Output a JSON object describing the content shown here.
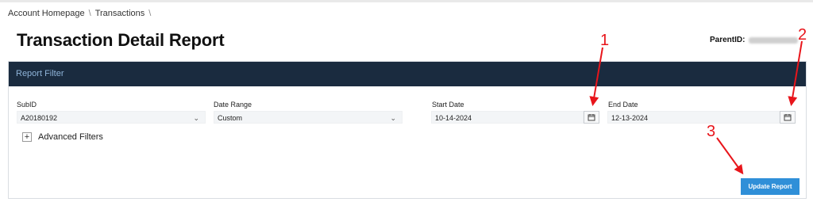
{
  "breadcrumb": {
    "items": [
      "Account Homepage",
      "Transactions"
    ],
    "separator": "\\"
  },
  "page": {
    "title": "Transaction Detail Report",
    "parent_label": "ParentID:"
  },
  "filter": {
    "header": "Report Filter",
    "subid": {
      "label": "SubID",
      "value": "A20180192"
    },
    "date_range": {
      "label": "Date Range",
      "value": "Custom"
    },
    "start_date": {
      "label": "Start Date",
      "value": "10-14-2024"
    },
    "end_date": {
      "label": "End Date",
      "value": "12-13-2024"
    },
    "advanced": "Advanced Filters",
    "update_button": "Update Report"
  },
  "annotations": {
    "one": "1",
    "two": "2",
    "three": "3",
    "color": "#e8151b"
  },
  "colors": {
    "header_bg": "#1a2b3f",
    "header_text": "#8fb4d9",
    "button": "#2f8fd8"
  }
}
